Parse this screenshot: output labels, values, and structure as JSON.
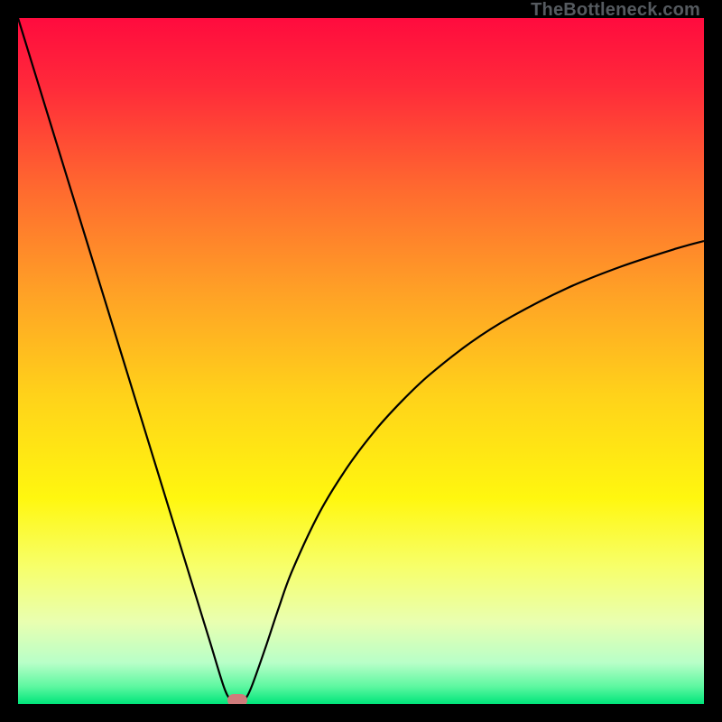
{
  "watermark": "TheBottleneck.com",
  "chart_data": {
    "type": "line",
    "title": "",
    "xlabel": "",
    "ylabel": "",
    "xlim": [
      0,
      100
    ],
    "ylim": [
      0,
      100
    ],
    "grid": false,
    "background": {
      "type": "vertical-gradient",
      "stops": [
        {
          "pos": 0.0,
          "color": "#ff0b3e"
        },
        {
          "pos": 0.1,
          "color": "#ff2a3a"
        },
        {
          "pos": 0.25,
          "color": "#ff6a2f"
        },
        {
          "pos": 0.4,
          "color": "#ffa126"
        },
        {
          "pos": 0.55,
          "color": "#ffd21a"
        },
        {
          "pos": 0.7,
          "color": "#fff70f"
        },
        {
          "pos": 0.8,
          "color": "#f7ff6a"
        },
        {
          "pos": 0.88,
          "color": "#e9ffb0"
        },
        {
          "pos": 0.94,
          "color": "#b8ffc8"
        },
        {
          "pos": 0.975,
          "color": "#5cf7a0"
        },
        {
          "pos": 1.0,
          "color": "#00e57a"
        }
      ]
    },
    "series": [
      {
        "name": "bottleneck-curve",
        "color": "#000000",
        "x": [
          0,
          2,
          4,
          6,
          8,
          10,
          12,
          14,
          16,
          18,
          20,
          22,
          24,
          26,
          28,
          30,
          31,
          32,
          33,
          34,
          36,
          38,
          40,
          44,
          48,
          52,
          56,
          60,
          66,
          72,
          80,
          88,
          96,
          100
        ],
        "y": [
          100,
          93.5,
          87,
          80.5,
          74,
          67.5,
          61,
          54.5,
          48,
          41.5,
          35,
          28.5,
          22,
          15.5,
          9,
          2.5,
          0.6,
          0,
          0.6,
          2.4,
          8,
          14,
          19.5,
          28,
          34.5,
          39.8,
          44.2,
          48,
          52.7,
          56.5,
          60.6,
          63.8,
          66.4,
          67.5
        ]
      }
    ],
    "marker": {
      "x": 32,
      "y": 0.5,
      "color": "#cf7b7b"
    }
  }
}
